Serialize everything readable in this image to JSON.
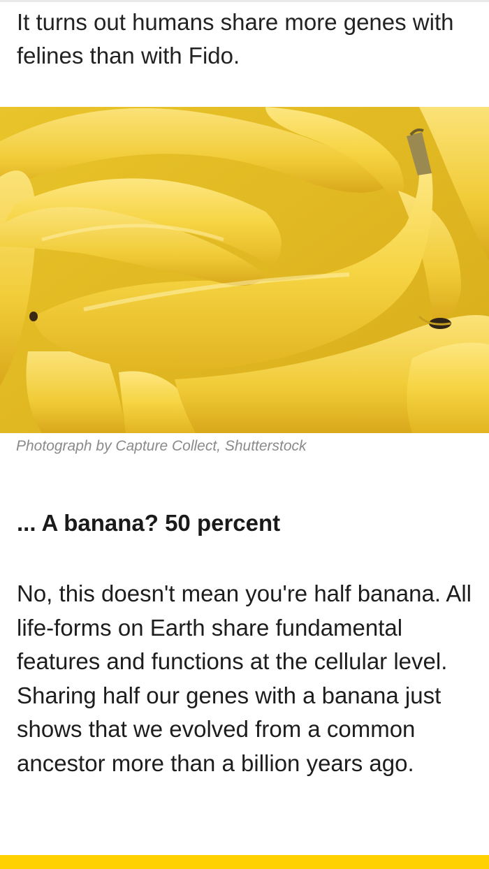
{
  "article": {
    "intro": "It turns out humans share more genes with felines than with Fido.",
    "photo": {
      "alt": "bananas"
    },
    "caption": "Photograph by Capture Collect, Shutterstock",
    "subhead": "... A banana? 50 percent",
    "body": "No, this doesn't mean you're half banana. All life-forms on Earth share fundamental features and functions at the cellular level. Sharing half our genes with a banana just shows that we evolved from a common ancestor more than a billion years ago."
  },
  "colors": {
    "accent_bar": "#ffd100",
    "caption_text": "#8a8a8a"
  }
}
